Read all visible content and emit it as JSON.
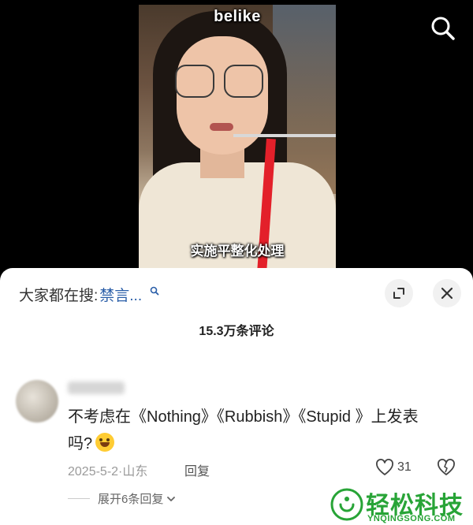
{
  "video": {
    "top_caption": "belike",
    "subtitle": "实施平整化处理"
  },
  "top_bar": {
    "search_icon": "search-icon"
  },
  "sheet": {
    "search_hint_prefix": "大家都在搜:",
    "search_hint_keyword": "禁言...",
    "comment_count": "15.3万条评论",
    "expand_icon": "expand-icon",
    "close_icon": "close-icon"
  },
  "comment": {
    "text_line1": "不考虑在《Nothing》《Rubbish》《Stupid 》上发表",
    "text_line2": "吗?",
    "date_location": "2025-5-2·山东",
    "reply_label": "回复",
    "like_count": "31",
    "expand_replies": "展开6条回复"
  },
  "watermark": {
    "text": "轻松科技",
    "sub": "YNQINGSONG.COM"
  },
  "colors": {
    "keyword": "#2a5ea8",
    "watermark": "#28a437"
  }
}
